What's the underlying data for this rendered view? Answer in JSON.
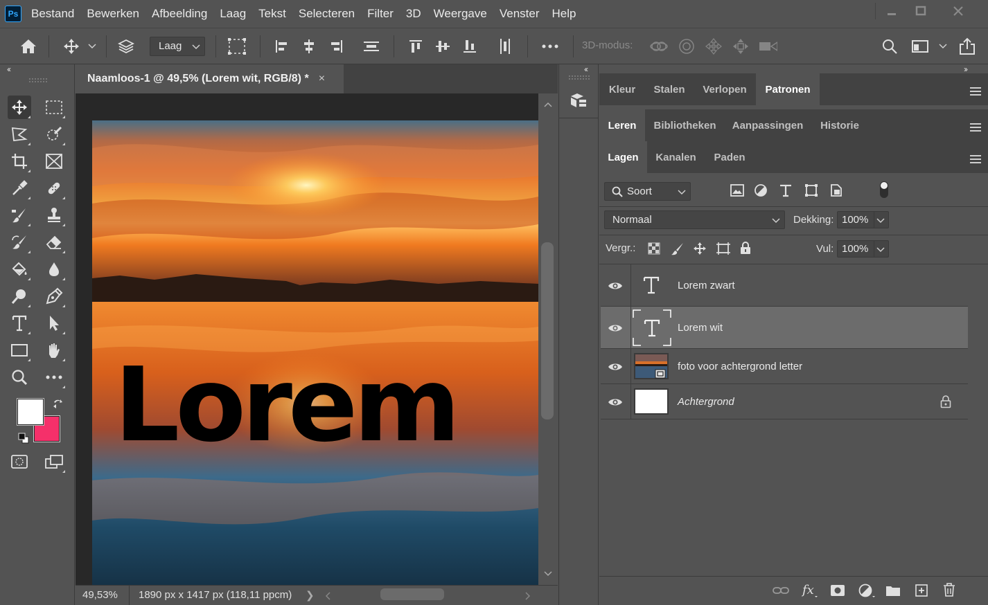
{
  "app": {
    "logo": "Ps"
  },
  "menu": [
    "Bestand",
    "Bewerken",
    "Afbeelding",
    "Laag",
    "Tekst",
    "Selecteren",
    "Filter",
    "3D",
    "Weergave",
    "Venster",
    "Help"
  ],
  "window_controls": [
    "minimize-icon",
    "restore-icon",
    "close-icon"
  ],
  "options_bar": {
    "layer_select": "Laag",
    "mode_3d_label": "3D-modus:",
    "icons": [
      "home-icon",
      "move-icon",
      "auto-select-layers-icon",
      "transform-controls-icon",
      "align-left-icon",
      "align-center-h-icon",
      "align-right-icon",
      "distribute-h-icon",
      "align-top-icon",
      "align-middle-v-icon",
      "align-bottom-icon",
      "distribute-v-icon",
      "more-icon",
      "orbit-3d-icon",
      "roll-3d-icon",
      "drag-3d-icon",
      "slide-3d-icon",
      "camera-3d-icon",
      "search-icon",
      "workspace-icon",
      "share-icon"
    ]
  },
  "document": {
    "tab_title": "Naamloos-1 @ 49,5% (Lorem wit, RGB/8) *",
    "tab_close": "×",
    "canvas_text": "Lorem",
    "zoom": "49,53%",
    "doc_info": "1890 px x 1417 px (118,11 ppcm)",
    "info_arrow": "❯"
  },
  "colors": {
    "foreground": "#ffffff",
    "background": "#f5306a",
    "panel_bg": "#535353",
    "dark_bg": "#424242",
    "canvas_bg": "#282828",
    "selected_layer": "#6c6c6c"
  },
  "panels": {
    "row1_tabs": [
      "Kleur",
      "Stalen",
      "Verlopen",
      "Patronen"
    ],
    "row1_active": "Patronen",
    "row2_tabs": [
      "Leren",
      "Bibliotheken",
      "Aanpassingen",
      "Historie"
    ],
    "row2_active": "Leren",
    "row3_tabs": [
      "Lagen",
      "Kanalen",
      "Paden"
    ],
    "row3_active": "Lagen"
  },
  "layers_panel": {
    "filter_kind": "Soort",
    "blend_mode": "Normaal",
    "opacity_label": "Dekking:",
    "opacity_value": "100%",
    "lock_label": "Vergr.:",
    "fill_label": "Vul:",
    "fill_value": "100%",
    "layers": [
      {
        "name": "Lorem zwart",
        "type": "text",
        "visible": true,
        "selected": false,
        "locked": false
      },
      {
        "name": "Lorem wit",
        "type": "text",
        "visible": true,
        "selected": true,
        "locked": false
      },
      {
        "name": "foto voor achtergrond letter",
        "type": "smart-object",
        "visible": true,
        "selected": false,
        "locked": false
      },
      {
        "name": "Achtergrond",
        "type": "background",
        "visible": true,
        "selected": false,
        "locked": true
      }
    ],
    "footer_icons": [
      "link-layers-icon",
      "fx-icon",
      "add-mask-icon",
      "adjustment-layer-icon",
      "new-group-icon",
      "new-layer-icon",
      "delete-layer-icon"
    ]
  }
}
